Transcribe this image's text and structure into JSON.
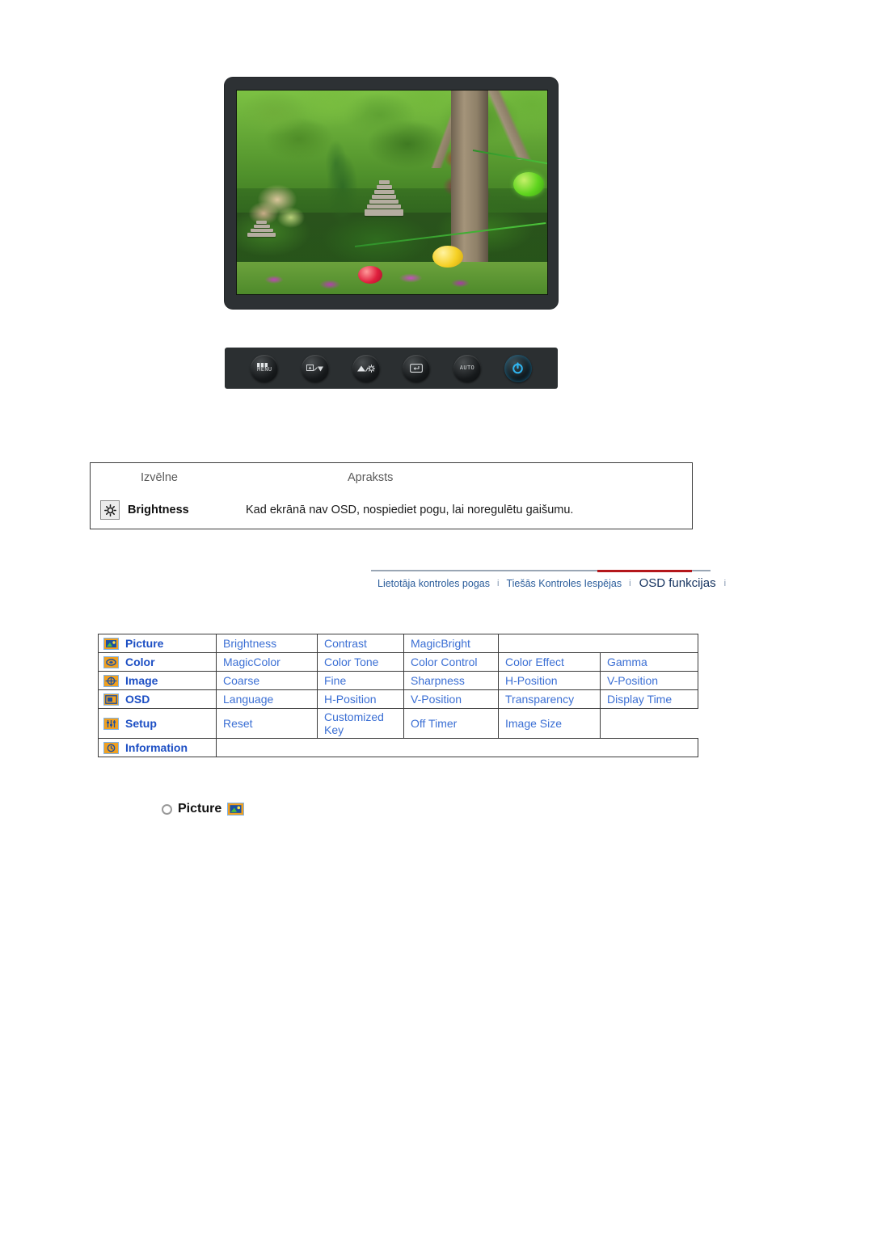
{
  "monitor": {
    "screen_alt": "garden-photo-with-stone-pagodas-and-paper-lanterns",
    "buttons": [
      {
        "name": "menu-button",
        "label": "MENU",
        "icon": "menu-icon"
      },
      {
        "name": "down-button",
        "label": "",
        "icon": "source-down-arrow-icon"
      },
      {
        "name": "up-brightness-button",
        "label": "",
        "icon": "up-brightness-icon"
      },
      {
        "name": "enter-button",
        "label": "",
        "icon": "enter-icon"
      },
      {
        "name": "auto-button",
        "label": "AUTO",
        "icon": "auto-icon"
      },
      {
        "name": "power-button",
        "label": "",
        "icon": "power-icon"
      }
    ]
  },
  "description_table": {
    "headers": {
      "menu": "Izvēlne",
      "description": "Apraksts"
    },
    "rows": [
      {
        "icon": "brightness-sun-icon",
        "label": "Brightness",
        "description": "Kad ekrānā nav OSD, nospiediet pogu, lai noregulētu gaišumu."
      }
    ]
  },
  "navbar": {
    "items": [
      {
        "label": "Lietotāja kontroles pogas",
        "active": false
      },
      {
        "label": "Tiešās Kontroles Iespējas",
        "active": false
      },
      {
        "label": "OSD funkcijas",
        "active": true
      }
    ],
    "separator": "i",
    "accent_color": "#b4171b",
    "link_color": "#2b5d9b",
    "active_color": "#13315e"
  },
  "osd_menu": {
    "rows": [
      {
        "category": "Picture",
        "icon": "picture-icon",
        "items": [
          "Brightness",
          "Contrast",
          "MagicBright"
        ]
      },
      {
        "category": "Color",
        "icon": "color-icon",
        "items": [
          "MagicColor",
          "Color Tone",
          "Color Control",
          "Color Effect",
          "Gamma"
        ]
      },
      {
        "category": "Image",
        "icon": "image-icon",
        "items": [
          "Coarse",
          "Fine",
          "Sharpness",
          "H-Position",
          "V-Position"
        ]
      },
      {
        "category": "OSD",
        "icon": "osd-icon",
        "items": [
          "Language",
          "H-Position",
          "V-Position",
          "Transparency",
          "Display Time"
        ]
      },
      {
        "category": "Setup",
        "icon": "setup-icon",
        "items": [
          "Reset",
          "Customized Key",
          "Off Timer",
          "Image Size"
        ]
      },
      {
        "category": "Information",
        "icon": "information-icon",
        "items": []
      }
    ],
    "text_color": "#3b6fd4",
    "category_color": "#1d4fc4",
    "icon_color": "#f0a020"
  },
  "section": {
    "bullet": "circle-bullet-icon",
    "title": "Picture",
    "icon": "picture-icon"
  }
}
